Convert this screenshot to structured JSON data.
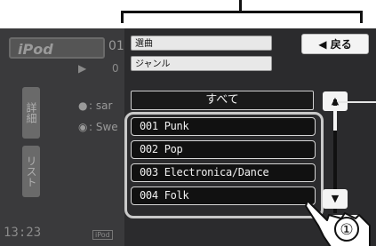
{
  "background": {
    "ipod_label": "iPod",
    "track_number": "01",
    "play_symbol": "▶",
    "play_symbol_2": "0",
    "detail_button": "詳細",
    "list_button": "リスト",
    "artist_fragment": ": sar",
    "album_fragment": ": Swe",
    "clock": "13:23",
    "ipod_badge": "iPod"
  },
  "panel": {
    "field_song": "選曲",
    "field_genre": "ジャンル",
    "back_button": "◀ 戻る",
    "all_button": "すべて",
    "items": [
      {
        "label": "001 Punk"
      },
      {
        "label": "002 Pop"
      },
      {
        "label": "003 Electronica/Dance"
      },
      {
        "label": "004 Folk"
      }
    ],
    "scroll_up": "▲",
    "scroll_down": "▼",
    "close_button": "×"
  },
  "annotations": {
    "step_marker": "①"
  },
  "colors": {
    "panel_bg": "#2b2b2d",
    "item_bg": "#111111",
    "field_bg": "#e8e8e8",
    "highlight_border": "#c9c9c9"
  }
}
